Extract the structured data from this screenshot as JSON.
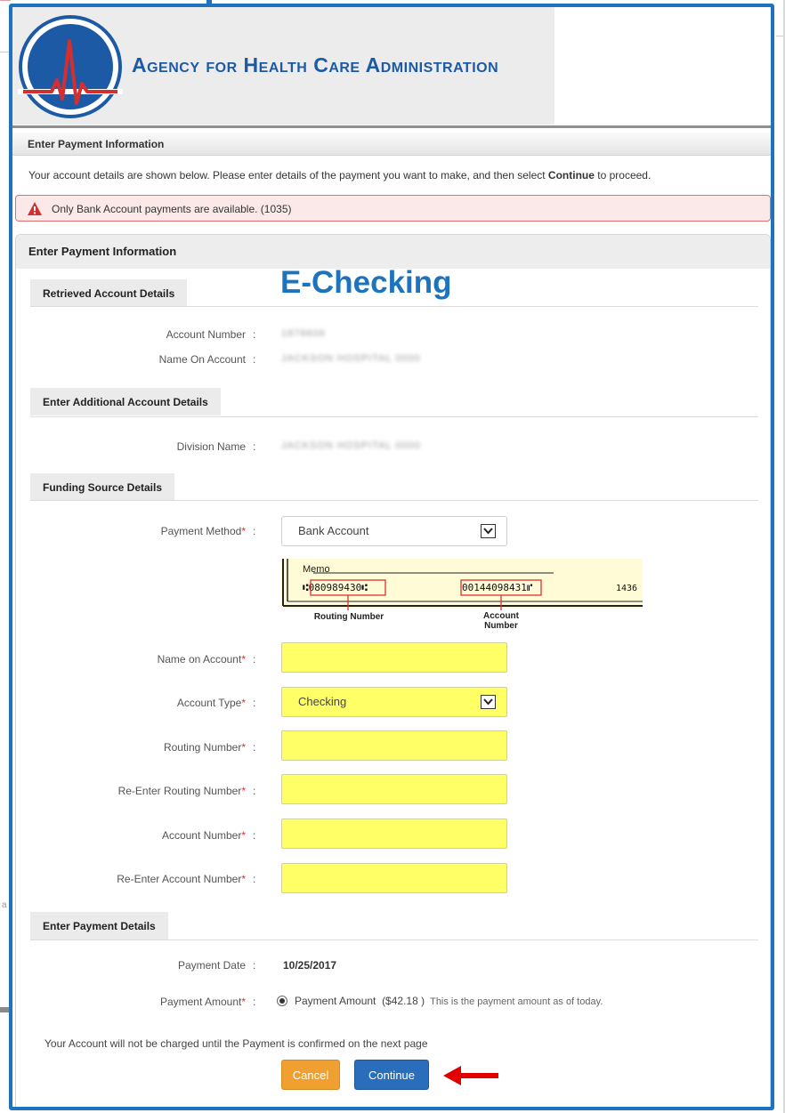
{
  "header": {
    "agency_title": "Agency for Health Care Administration"
  },
  "page": {
    "section_title": "Enter Payment Information",
    "intro_before": "Your account details are shown below. Please enter details of the payment you want to make, and then select ",
    "intro_bold": "Continue",
    "intro_after": " to proceed."
  },
  "alert": {
    "text": "Only Bank Account payments are available. (1035)",
    "color": "#d32f2f"
  },
  "panel": {
    "title": "Enter Payment Information",
    "annotation": "E-Checking"
  },
  "retrieved": {
    "heading": "Retrieved Account Details",
    "account_number_label": "Account Number",
    "account_number_value": "1878606",
    "name_on_account_label": "Name On Account",
    "name_on_account_value": "JACKSON HOSPITAL 0000"
  },
  "additional": {
    "heading": "Enter Additional Account Details",
    "division_label": "Division Name",
    "division_value": "JACKSON HOSPITAL 0000"
  },
  "funding": {
    "heading": "Funding Source Details",
    "payment_method_label": "Payment Method",
    "payment_method_value": "Bank Account",
    "check": {
      "memo": "Memo",
      "routing_digits": "⑆080989430⑆",
      "account_digits": "00144098431⑈",
      "check_number": "1436",
      "routing_caption": "Routing Number",
      "account_caption_1": "Account",
      "account_caption_2": "Number"
    },
    "name_on_account_label": "Name on Account",
    "account_type_label": "Account Type",
    "account_type_value": "Checking",
    "routing_label": "Routing Number",
    "reenter_routing_label": "Re-Enter Routing Number",
    "account_number_label": "Account Number",
    "reenter_account_label": "Re-Enter Account Number",
    "colon": ":",
    "required_mark": "*"
  },
  "payment": {
    "heading": "Enter Payment Details",
    "date_label": "Payment Date",
    "date_value": "10/25/2017",
    "amount_label": "Payment Amount",
    "amount_option": "Payment Amount",
    "amount_value": "($42.18 )",
    "amount_note": "This is the payment amount as of today."
  },
  "footer": {
    "confirm_note": "Your Account will not be charged until the Payment is confirmed on the next page",
    "cancel_label": "Cancel",
    "continue_label": "Continue"
  },
  "colors": {
    "frame_blue": "#1e73be",
    "field_yellow": "#ffff66",
    "cancel_orange": "#f0a030",
    "continue_blue": "#2a6ebb",
    "arrow_red": "#e00000"
  },
  "icons": {
    "logo": "heartbeat-logo-icon",
    "alert": "warning-triangle-icon",
    "dropdown": "chevron-down-icon",
    "arrow": "red-arrow-icon"
  }
}
